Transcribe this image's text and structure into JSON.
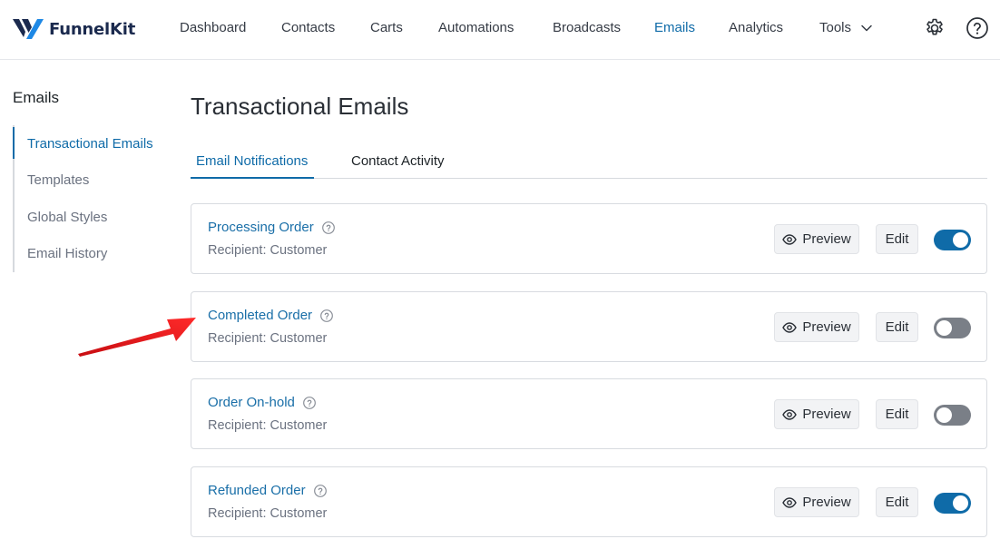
{
  "brand": {
    "name": "FunnelKit"
  },
  "nav": {
    "items": [
      {
        "label": "Dashboard"
      },
      {
        "label": "Contacts"
      },
      {
        "label": "Carts"
      },
      {
        "label": "Automations"
      },
      {
        "label": "Broadcasts"
      },
      {
        "label": "Emails"
      },
      {
        "label": "Analytics"
      },
      {
        "label": "Tools"
      }
    ],
    "active": "Emails",
    "icons": [
      "chevron-down-icon",
      "gear-icon",
      "help-circle-icon"
    ]
  },
  "sidebar": {
    "title": "Emails",
    "items": [
      {
        "label": "Transactional Emails"
      },
      {
        "label": "Templates"
      },
      {
        "label": "Global Styles"
      },
      {
        "label": "Email History"
      }
    ],
    "active": "Transactional Emails"
  },
  "main": {
    "title": "Transactional Emails",
    "tabs": [
      {
        "label": "Email Notifications"
      },
      {
        "label": "Contact Activity"
      }
    ],
    "active_tab": "Email Notifications",
    "emails": [
      {
        "name": "Processing Order",
        "recipient": "Recipient: Customer",
        "preview_label": "Preview",
        "edit_label": "Edit",
        "enabled": true
      },
      {
        "name": "Completed Order",
        "recipient": "Recipient: Customer",
        "preview_label": "Preview",
        "edit_label": "Edit",
        "enabled": false
      },
      {
        "name": "Order On-hold",
        "recipient": "Recipient: Customer",
        "preview_label": "Preview",
        "edit_label": "Edit",
        "enabled": false
      },
      {
        "name": "Refunded Order",
        "recipient": "Recipient: Customer",
        "preview_label": "Preview",
        "edit_label": "Edit",
        "enabled": true
      }
    ]
  },
  "colors": {
    "accent": "#0f6ba8",
    "toggle_off": "#7a7f87",
    "annotation_arrow": "#e8141b"
  }
}
